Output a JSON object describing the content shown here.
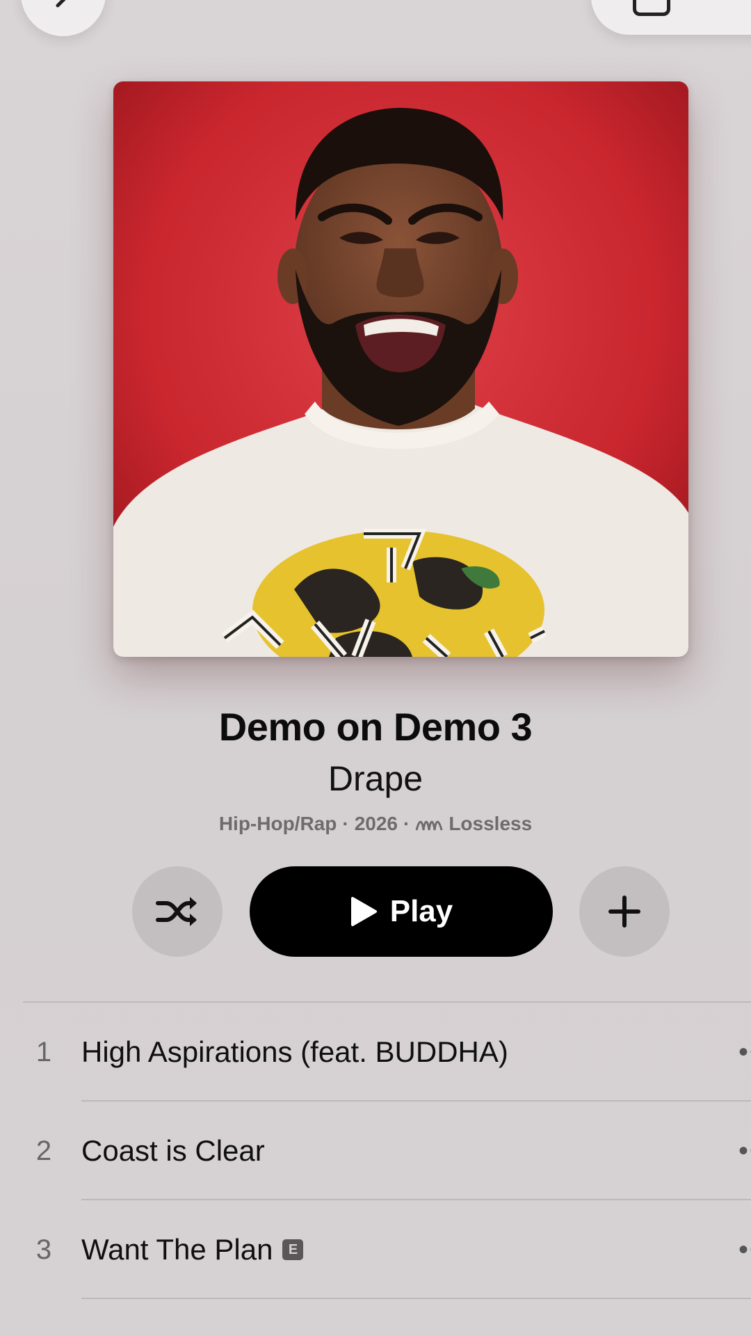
{
  "album": {
    "title": "Demo on Demo 3",
    "artist": "Drape",
    "genre": "Hip-Hop/Rap",
    "year": "2026",
    "quality": "Lossless",
    "separator": "·"
  },
  "actions": {
    "play_label": "Play"
  },
  "tracks": [
    {
      "number": "1",
      "title": "High Aspirations (feat. BUDDHA)",
      "explicit": false
    },
    {
      "number": "2",
      "title": "Coast is Clear",
      "explicit": false
    },
    {
      "number": "3",
      "title": "Want The Plan",
      "explicit": true,
      "explicit_badge": "E"
    }
  ],
  "track_more": "••",
  "icons": {
    "back": "chevron-left-icon",
    "top_right": "square-icon",
    "shuffle": "shuffle-icon",
    "play": "play-icon",
    "add": "plus-icon",
    "lossless": "lossless-wave-icon"
  },
  "colors": {
    "background": "#d6d1d3",
    "play_button": "#000000",
    "secondary_button": "#c3bec0",
    "artwork_background": "#c9262e"
  }
}
